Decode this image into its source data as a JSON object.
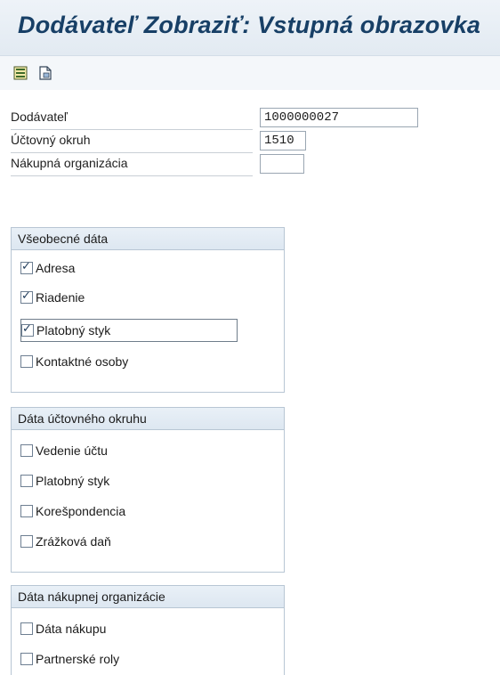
{
  "title": "Dodávateľ Zobraziť: Vstupná obrazovka",
  "toolbar": {
    "buttons": [
      {
        "icon": "list-document-icon"
      },
      {
        "icon": "document-icon"
      }
    ]
  },
  "fields": [
    {
      "label": "Dodávateľ",
      "value": "1000000027"
    },
    {
      "label": "Účtovný okruh",
      "value": "1510"
    },
    {
      "label": "Nákupná organizácia",
      "value": ""
    }
  ],
  "groups": [
    {
      "title": "Všeobecné dáta",
      "items": [
        {
          "label": "Adresa",
          "checked": true
        },
        {
          "label": "Riadenie",
          "checked": true
        },
        {
          "label": "Platobný styk",
          "checked": true
        },
        {
          "label": "Kontaktné osoby",
          "checked": false
        }
      ]
    },
    {
      "title": "Dáta účtovného okruhu",
      "items": [
        {
          "label": "Vedenie účtu",
          "checked": false
        },
        {
          "label": "Platobný styk",
          "checked": false
        },
        {
          "label": "Korešpondencia",
          "checked": false
        },
        {
          "label": "Zrážková daň",
          "checked": false
        }
      ]
    },
    {
      "title": "Dáta nákupnej organizácie",
      "items": [
        {
          "label": "Dáta nákupu",
          "checked": false
        },
        {
          "label": "Partnerské roly",
          "checked": false
        }
      ]
    }
  ]
}
